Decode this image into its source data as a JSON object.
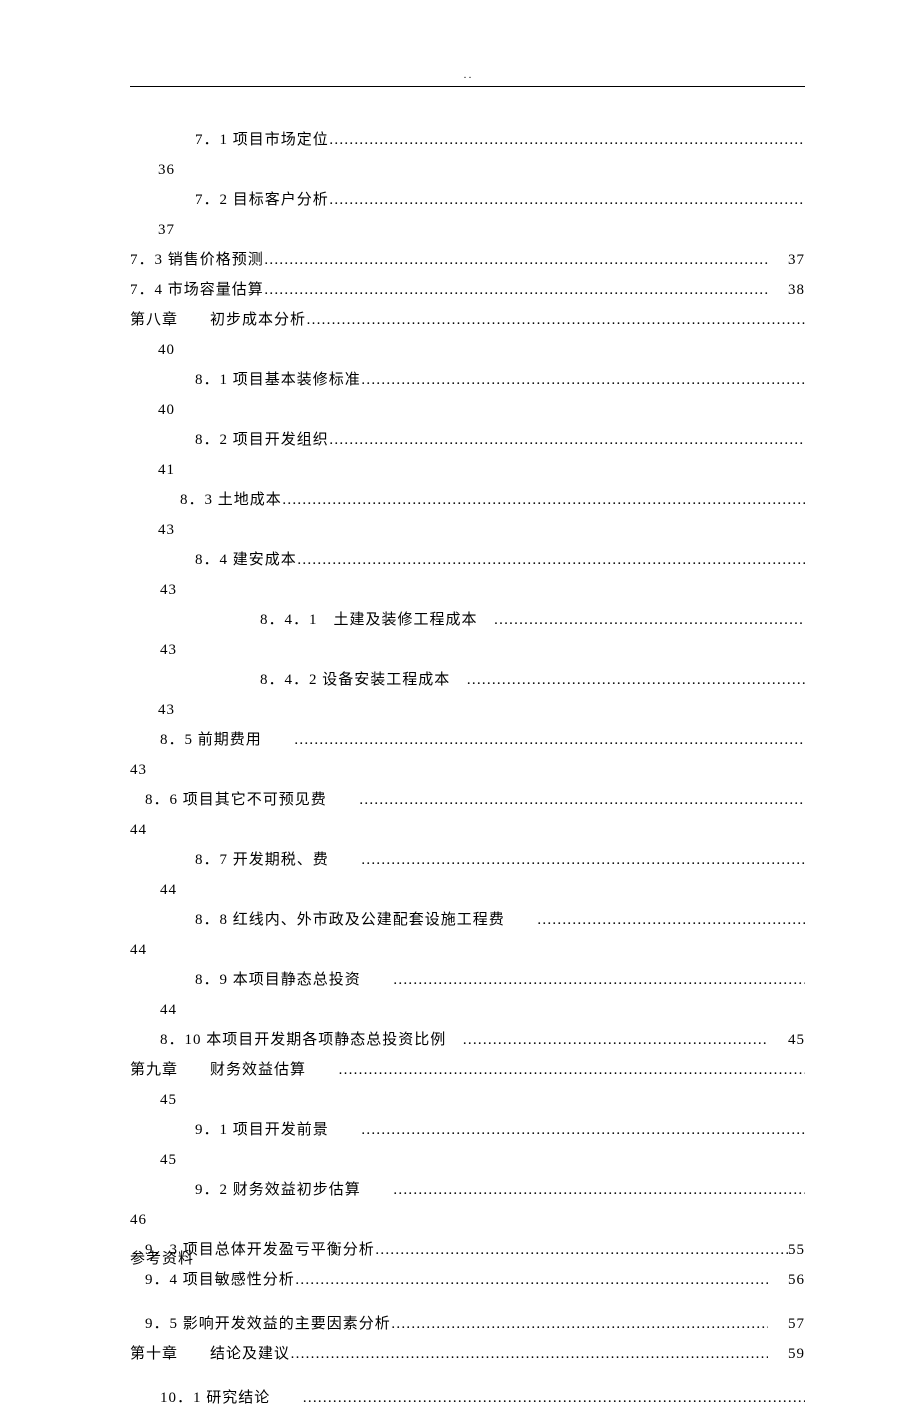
{
  "header_dots": ". .",
  "toc": [
    {
      "indent": "indent1",
      "title": "7．1 项目市场定位",
      "page": "",
      "page_below": "36",
      "leader": true
    },
    {
      "indent": "indent1",
      "title": "7．2 目标客户分析",
      "page": "",
      "page_below": "37",
      "leader": true
    },
    {
      "indent": "indent0",
      "title": "7．3 销售价格预测 ",
      "page": "37",
      "leader": true
    },
    {
      "indent": "indent0",
      "title": "7．4 市场容量估算 ",
      "page": "38",
      "leader": true
    },
    {
      "indent": "indent0",
      "title": "第八章　　初步成本分析",
      "page": "",
      "page_below": "40",
      "leader": true
    },
    {
      "indent": "indent1",
      "title": "8．1 项目基本装修标准",
      "page": "",
      "page_below": "40",
      "leader": true
    },
    {
      "indent": "indent1",
      "title": "8．2 项目开发组织",
      "page": "",
      "page_below": "41",
      "leader": true
    },
    {
      "indent": "indent2",
      "title": "8．3 土地成本",
      "page": "",
      "page_below": "43",
      "leader": true
    },
    {
      "indent": "indent1",
      "title": "8．4 建安成本",
      "page": "",
      "page_below": " 43",
      "indent_below": "indent3",
      "leader": true
    },
    {
      "indent": "indent5",
      "title": "8．4．1　土建及装修工程成本　",
      "page": "",
      "page_below": " 43",
      "indent_below": "indent3",
      "leader": true
    },
    {
      "indent": "indent5",
      "title": "8．4．2 设备安装工程成本　",
      "page": "",
      "page_below": "43",
      "leader": true
    },
    {
      "indent": "indent3",
      "title": "8．5 前期费用　　",
      "page": "",
      "page_below": "43",
      "indent_below": "indent0",
      "leader": true
    },
    {
      "indent": "indent4",
      "title": "8．6 项目其它不可预见费　　",
      "page": "",
      "page_below": "44",
      "indent_below": "indent0",
      "leader": true
    },
    {
      "indent": "indent1",
      "title": "8．7 开发期税、费　　",
      "page": "",
      "page_below": " 44",
      "indent_below": "indent3",
      "leader": true
    },
    {
      "indent": "indent1",
      "title": "8．8 红线内、外市政及公建配套设施工程费　　",
      "page": "",
      "page_below": "44",
      "indent_below": "indent0",
      "leader": true
    },
    {
      "indent": "indent1",
      "title": "8．9 本项目静态总投资　　",
      "page": "",
      "page_below": " 44",
      "indent_below": "indent3",
      "leader": true
    },
    {
      "indent": "indent3",
      "title": "8．10 本项目开发期各项静态总投资比例　",
      "page": "45",
      "leader": true
    },
    {
      "indent": "indent0",
      "title": "第九章　　财务效益估算　　",
      "page": "",
      "page_below": " 45",
      "indent_below": "indent3",
      "leader": true
    },
    {
      "indent": "indent1",
      "title": "9．1 项目开发前景　　",
      "page": "",
      "page_below": " 45",
      "indent_below": "indent3",
      "leader": true
    },
    {
      "indent": "indent1",
      "title": "9．2 财务效益初步估算　　",
      "page": "",
      "page_below": "46",
      "indent_below": "indent0",
      "leader": true
    },
    {
      "indent": "indent4",
      "title": "9．3 项目总体开发盈亏平衡分析",
      "page": "55",
      "page_inline_tight": true,
      "leader": true
    },
    {
      "indent": "indent4",
      "title": "9．4 项目敏感性分析",
      "page": "56",
      "leader": true,
      "gap_after": true
    },
    {
      "indent": "indent4",
      "title": "9．5 影响开发效益的主要因素分析",
      "page": "57",
      "leader": true
    },
    {
      "indent": "indent0",
      "title": "第十章　　结论及建议",
      "page": "59",
      "leader": true,
      "gap_after": true
    },
    {
      "indent": "indent3",
      "title": "10．1 研究结论　　",
      "page": "",
      "leader": true
    }
  ],
  "footer": "参考资料"
}
